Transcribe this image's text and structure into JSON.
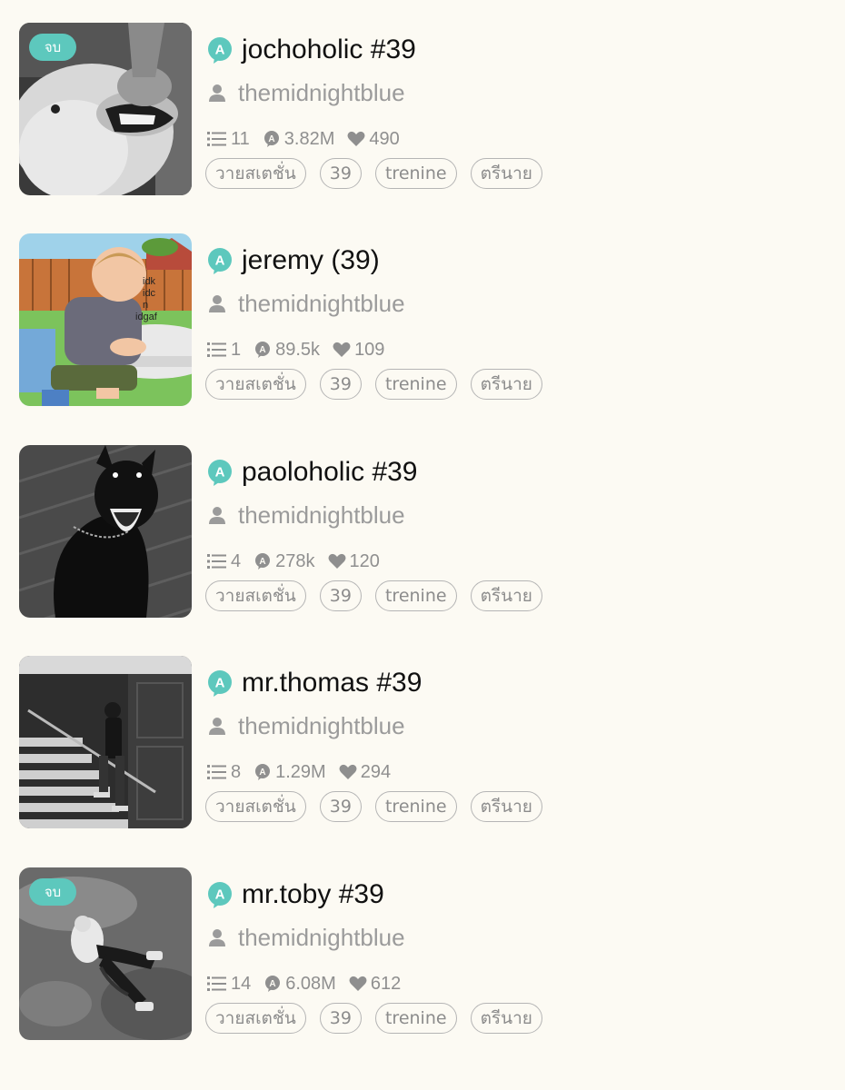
{
  "stories": [
    {
      "status": "จบ",
      "title": "jochoholic #39",
      "author": "themidnightblue",
      "chapters": "11",
      "views": "3.82M",
      "likes": "490",
      "tags": [
        "วายสเตชั่น",
        "39",
        "trenine",
        "ตรีนาย"
      ],
      "cover": "dog-biting-hand"
    },
    {
      "status": null,
      "title": "jeremy (39)",
      "author": "themidnightblue",
      "chapters": "1",
      "views": "89.5k",
      "likes": "109",
      "tags": [
        "วายสเตชั่น",
        "39",
        "trenine",
        "ตรีนาย"
      ],
      "cover": "cartoon-boy-meme",
      "cover_text": [
        "idk",
        "idc",
        "n",
        "idgaf"
      ]
    },
    {
      "status": null,
      "title": "paoloholic #39",
      "author": "themidnightblue",
      "chapters": "4",
      "views": "278k",
      "likes": "120",
      "tags": [
        "วายสเตชั่น",
        "39",
        "trenine",
        "ตรีนาย"
      ],
      "cover": "black-doberman"
    },
    {
      "status": null,
      "title": "mr.thomas #39",
      "author": "themidnightblue",
      "chapters": "8",
      "views": "1.29M",
      "likes": "294",
      "tags": [
        "วายสเตชั่น",
        "39",
        "trenine",
        "ตรีนาย"
      ],
      "cover": "man-on-stairs"
    },
    {
      "status": "จบ",
      "title": "mr.toby #39",
      "author": "themidnightblue",
      "chapters": "14",
      "views": "6.08M",
      "likes": "612",
      "tags": [
        "วายสเตชั่น",
        "39",
        "trenine",
        "ตรีนาย"
      ],
      "cover": "man-lying-on-floor"
    }
  ],
  "colors": {
    "background": "#fcfaf3",
    "accent": "#5dc8bd",
    "muted_text": "#9b9b9b"
  }
}
